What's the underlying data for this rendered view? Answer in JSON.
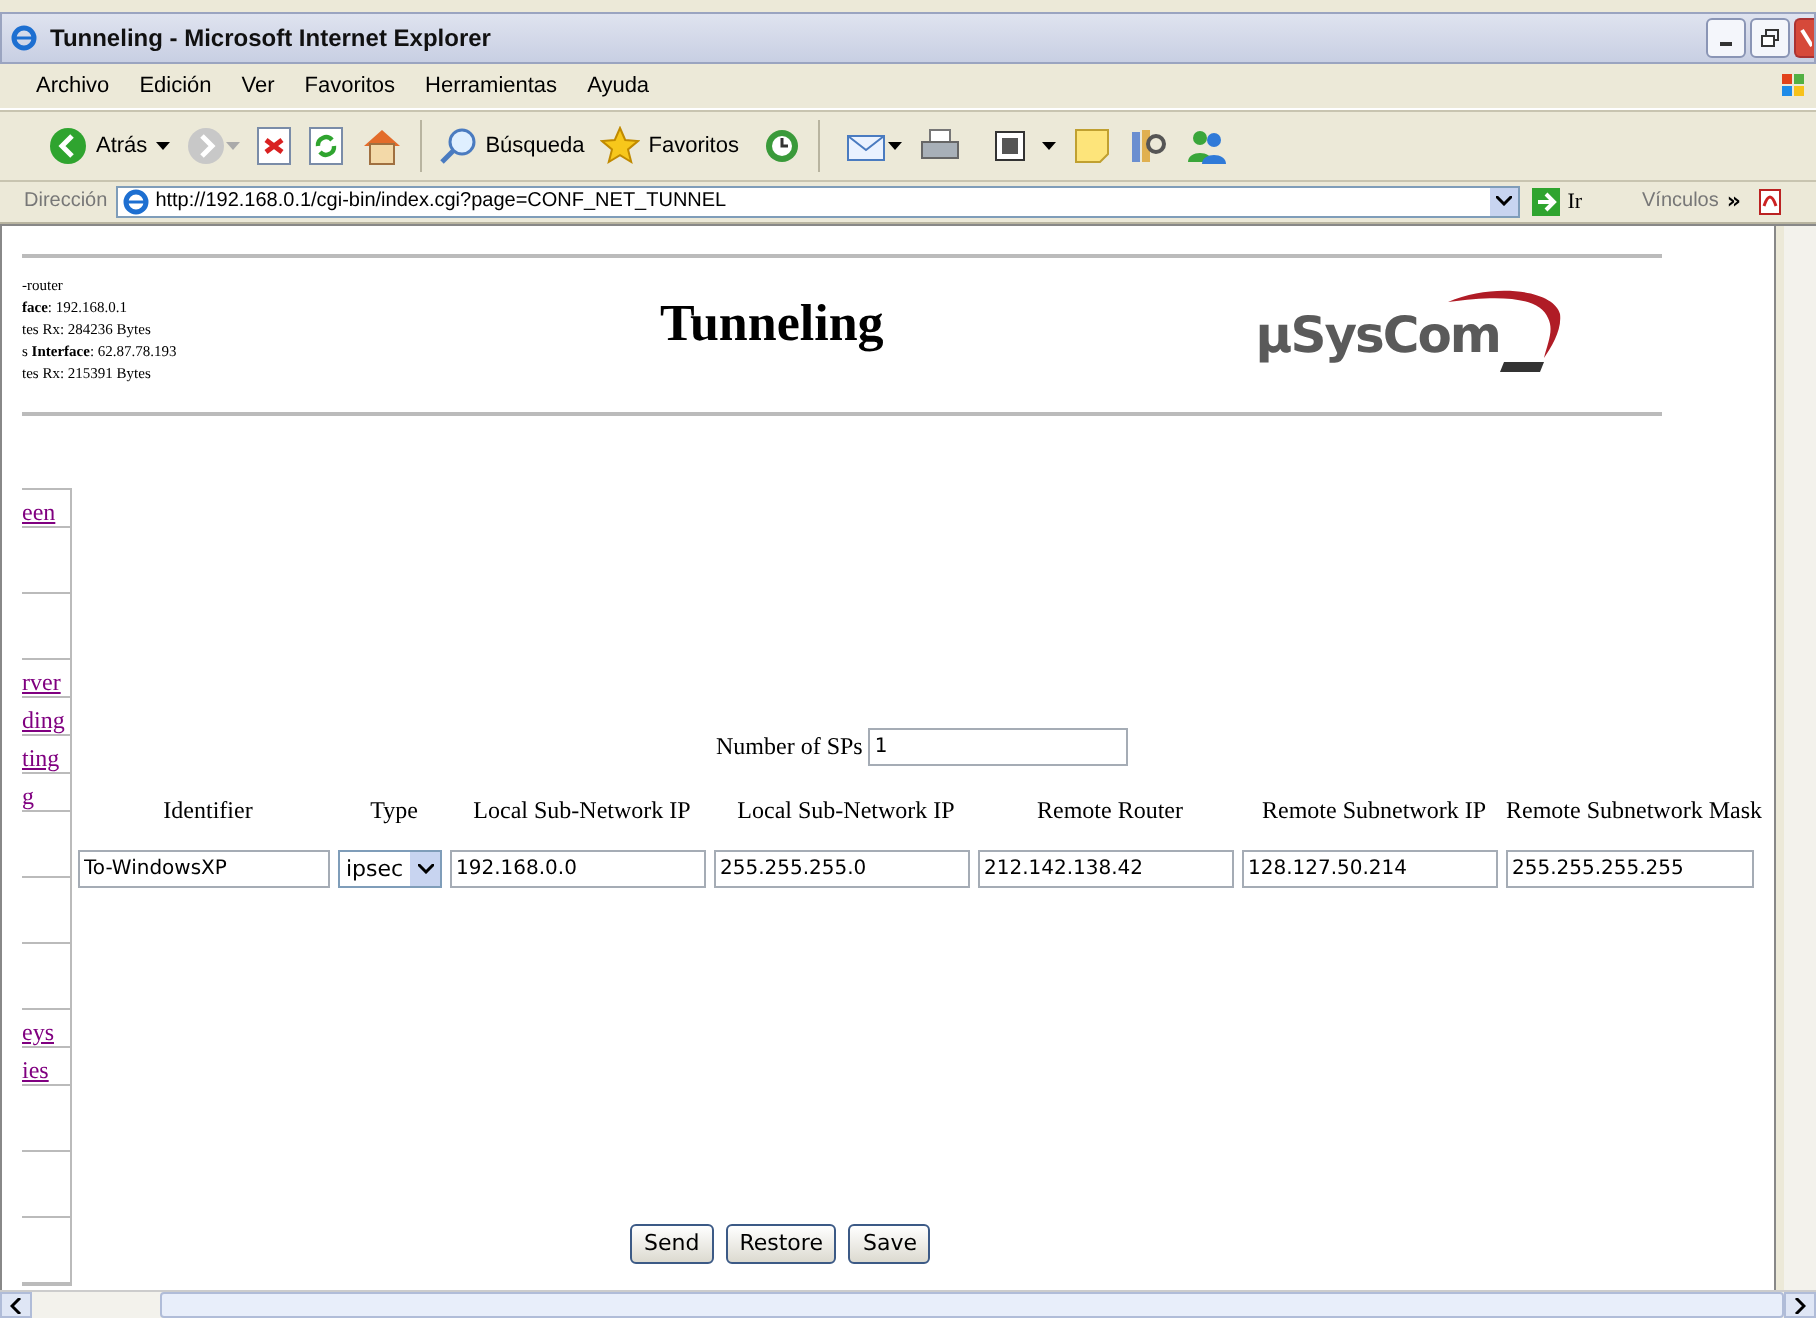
{
  "window": {
    "title": "Tunneling - Microsoft Internet Explorer"
  },
  "menu": [
    "Archivo",
    "Edición",
    "Ver",
    "Favoritos",
    "Herramientas",
    "Ayuda"
  ],
  "toolbar": {
    "back": "Atrás",
    "search": "Búsqueda",
    "favorites": "Favoritos"
  },
  "address": {
    "label": "Dirección",
    "url": "http://192.168.0.1/cgi-bin/index.cgi?page=CONF_NET_TUNNEL",
    "go": "Ir",
    "links": "Vínculos",
    "chevron": "»"
  },
  "router_info": [
    "-router",
    "**face**: 192.168.0.1",
    "tes Rx: 284236 Bytes",
    "s **Interface**: 62.87.78.193",
    "tes Rx: 215391 Bytes"
  ],
  "page_title": "Tunneling",
  "logo": {
    "text": "µSysCom"
  },
  "sidebar": [
    {
      "kind": "link",
      "label": "een"
    },
    {
      "kind": "empty"
    },
    {
      "kind": "empty"
    },
    {
      "kind": "link",
      "label": "rver"
    },
    {
      "kind": "link",
      "label": "ding"
    },
    {
      "kind": "link",
      "label": "ting"
    },
    {
      "kind": "link",
      "label": "g"
    },
    {
      "kind": "empty"
    },
    {
      "kind": "empty"
    },
    {
      "kind": "empty"
    },
    {
      "kind": "link",
      "label": "eys"
    },
    {
      "kind": "link",
      "label": "ies"
    },
    {
      "kind": "empty"
    },
    {
      "kind": "empty"
    },
    {
      "kind": "empty"
    }
  ],
  "sp_count": {
    "label": "Number of SPs",
    "value": "1"
  },
  "table": {
    "columns": [
      "Identifier",
      "Type",
      "Local Sub-Network IP",
      "Local Sub-Network IP",
      "Remote Router",
      "Remote Subnetwork IP",
      "Remote Subnetwork Mask"
    ],
    "rows": [
      {
        "cells": [
          {
            "kind": "input",
            "value": "To-WindowsXP"
          },
          {
            "kind": "select",
            "value": "ipsec"
          },
          {
            "kind": "input",
            "value": "192.168.0.0"
          },
          {
            "kind": "input",
            "value": "255.255.255.0"
          },
          {
            "kind": "input",
            "value": "212.142.138.42"
          },
          {
            "kind": "input",
            "value": "128.127.50.214"
          },
          {
            "kind": "input",
            "value": "255.255.255.255"
          }
        ]
      }
    ]
  },
  "buttons": [
    "Send",
    "Restore",
    "Save"
  ]
}
